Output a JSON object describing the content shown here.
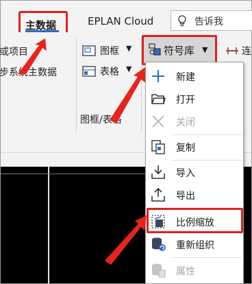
{
  "tabs": {
    "main_label": "主数据",
    "cloud_label": "EPLAN Cloud",
    "search_text": "告诉我"
  },
  "ribbon": {
    "left_items": [
      "或项目",
      "步系统主数据"
    ],
    "frame_label": "图框",
    "table_label": "表格",
    "group_label": "图框/表格",
    "symbol_library_label": "符号库",
    "partial_right_label": "连"
  },
  "menu": {
    "items": [
      {
        "label": "新建",
        "icon": "plus-icon",
        "enabled": true
      },
      {
        "label": "打开",
        "icon": "folder-icon",
        "enabled": true
      },
      {
        "label": "关闭",
        "icon": "close-icon",
        "enabled": false
      },
      {
        "label": "复制",
        "icon": "copy-icon",
        "enabled": true
      },
      {
        "label": "导入",
        "icon": "import-icon",
        "enabled": true
      },
      {
        "label": "导出",
        "icon": "export-icon",
        "enabled": true
      },
      {
        "label": "比例缩放",
        "icon": "scale-icon",
        "enabled": true
      },
      {
        "label": "重新组织",
        "icon": "reorganize-icon",
        "enabled": true
      },
      {
        "label": "属性",
        "icon": "properties-icon",
        "enabled": false
      }
    ]
  },
  "colors": {
    "highlight": "#e02020",
    "accent_blue": "#2b6cc4",
    "canvas": "#000000"
  }
}
